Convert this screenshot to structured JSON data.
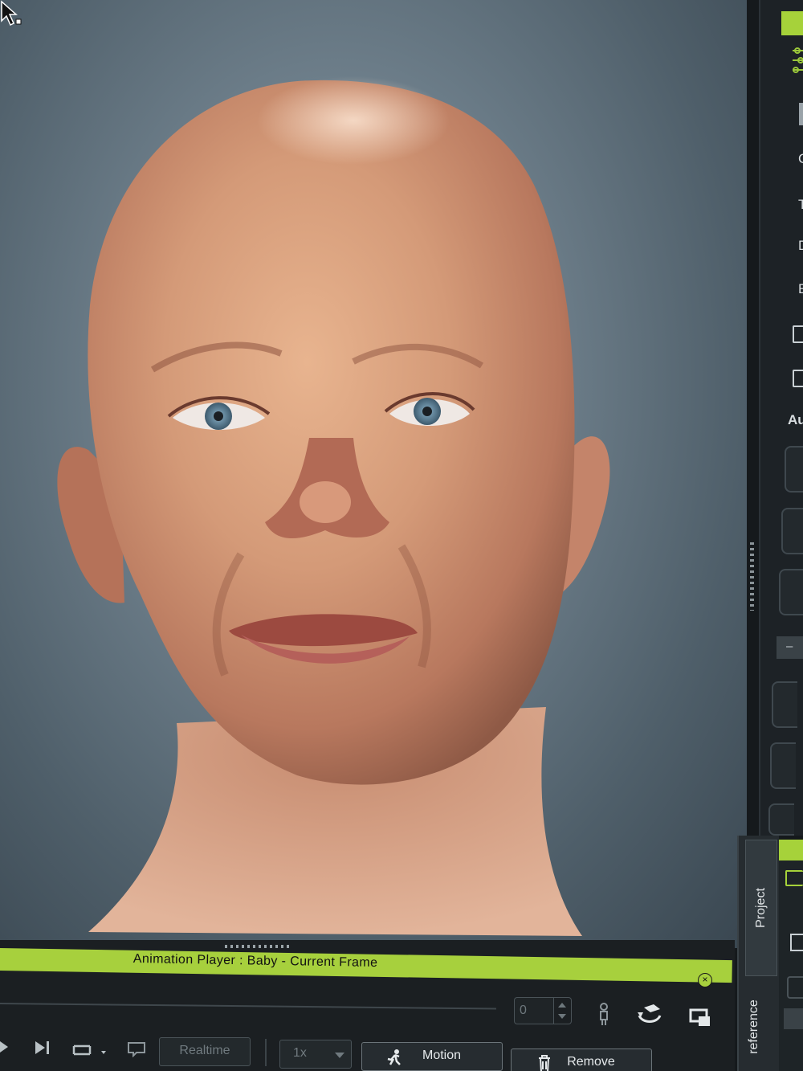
{
  "animation_player": {
    "title": "Animation Player : Baby - Current Frame",
    "close_icon": "×",
    "current_frame": "0",
    "realtime_label": "Realtime",
    "speed_value": "1x",
    "motion_label": "Motion",
    "remove_label": "Remove"
  },
  "right_panel": {
    "partial_labels": [
      "C",
      "T",
      "D",
      "E"
    ],
    "section_label": "Au",
    "minus_label": "–"
  },
  "tabs": {
    "project": "Project",
    "preference": "reference"
  },
  "icons": [
    "settings-sliders-icon",
    "mouse-pointer-icon",
    "step-forward-icon",
    "loop-icon",
    "subtitle-icon",
    "character-pose-icon",
    "camera-rotate-icon",
    "window-icon",
    "motion-run-icon",
    "trash-icon",
    "folder-icon",
    "checkbox-icon"
  ],
  "colors": {
    "accent": "#a7d03d",
    "panel": "#1b1f22",
    "viewport": "#6f808c"
  }
}
